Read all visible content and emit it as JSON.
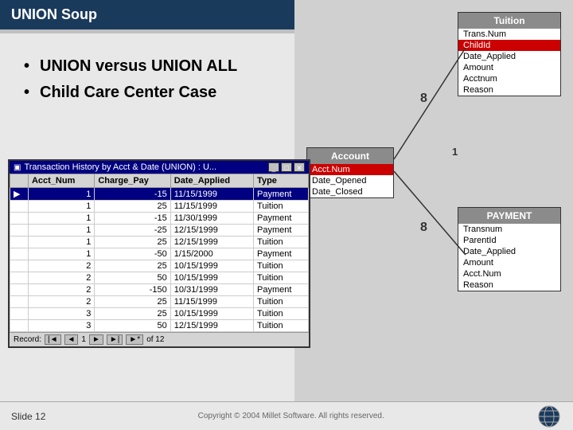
{
  "header": {
    "title": "UNION Soup"
  },
  "bullets": [
    "UNION versus UNION ALL",
    "Child Care Center Case"
  ],
  "tuition_box": {
    "header": "Tuition",
    "fields": [
      "Trans.Num",
      "ChildId",
      "Date_Applied",
      "Amount",
      "Acctnum",
      "Reason"
    ],
    "highlighted_field": "ChildId"
  },
  "payment_box": {
    "header": "PAYMENT",
    "fields": [
      "Transnum",
      "ParentId",
      "Date_Applied",
      "Amount",
      "Acct.Num",
      "Reason"
    ]
  },
  "account_box": {
    "header": "Account",
    "fields": [
      "Acct.Num",
      "Date_Opened",
      "Date_Closed"
    ],
    "highlighted_field": "Acct.Num"
  },
  "transaction_window": {
    "title": "Transaction History by Acct & Date (UNION) : U...",
    "columns": [
      "",
      "Acct_Num",
      "Charge_Pay",
      "Date_Applied",
      "Type"
    ],
    "rows": [
      {
        "selector": true,
        "acct_num": "1",
        "charge_pay": "-15",
        "date_applied": "11/15/1999",
        "type": "Payment"
      },
      {
        "selector": false,
        "acct_num": "1",
        "charge_pay": "25",
        "date_applied": "11/15/1999",
        "type": "Tuition"
      },
      {
        "selector": false,
        "acct_num": "1",
        "charge_pay": "-15",
        "date_applied": "11/30/1999",
        "type": "Payment"
      },
      {
        "selector": false,
        "acct_num": "1",
        "charge_pay": "-25",
        "date_applied": "12/15/1999",
        "type": "Payment"
      },
      {
        "selector": false,
        "acct_num": "1",
        "charge_pay": "25",
        "date_applied": "12/15/1999",
        "type": "Tuition"
      },
      {
        "selector": false,
        "acct_num": "1",
        "charge_pay": "-50",
        "date_applied": "1/15/2000",
        "type": "Payment"
      },
      {
        "selector": false,
        "acct_num": "2",
        "charge_pay": "25",
        "date_applied": "10/15/1999",
        "type": "Tuition"
      },
      {
        "selector": false,
        "acct_num": "2",
        "charge_pay": "50",
        "date_applied": "10/15/1999",
        "type": "Tuition"
      },
      {
        "selector": false,
        "acct_num": "2",
        "charge_pay": "-150",
        "date_applied": "10/31/1999",
        "type": "Payment"
      },
      {
        "selector": false,
        "acct_num": "2",
        "charge_pay": "25",
        "date_applied": "11/15/1999",
        "type": "Tuition"
      },
      {
        "selector": false,
        "acct_num": "3",
        "charge_pay": "25",
        "date_applied": "10/15/1999",
        "type": "Tuition"
      },
      {
        "selector": false,
        "acct_num": "3",
        "charge_pay": "50",
        "date_applied": "12/15/1999",
        "type": "Tuition"
      }
    ],
    "nav": {
      "record_label": "Record:",
      "current": "1",
      "total": "of 12"
    }
  },
  "footer": {
    "slide": "Slide 12",
    "copyright": "Copyright © 2004 Millet Software. All rights reserved."
  },
  "connector": {
    "symbol_8_top": "8",
    "symbol_8_bottom": "8",
    "symbol_1": "1"
  }
}
